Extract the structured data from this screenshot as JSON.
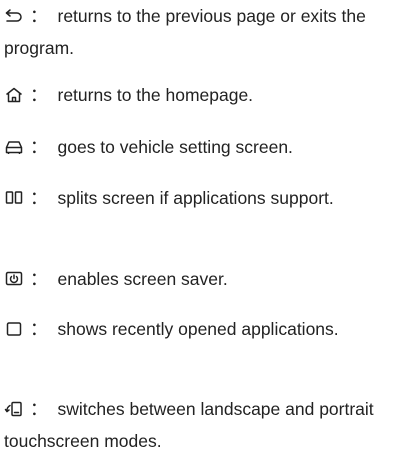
{
  "items": [
    {
      "icon": "back-arrow-icon",
      "colon": "：",
      "text": "returns to the previous page or exits the program."
    },
    {
      "icon": "home-icon",
      "colon": "：",
      "text": "returns to the homepage."
    },
    {
      "icon": "vehicle-icon",
      "colon": "：",
      "text": "goes to vehicle setting screen."
    },
    {
      "icon": "split-screen-icon",
      "colon": "：",
      "text": "splits screen if applications support."
    },
    {
      "icon": "screen-saver-icon",
      "colon": "：",
      "text": "enables screen saver."
    },
    {
      "icon": "recent-apps-icon",
      "colon": "：",
      "text": "shows recently opened applications."
    },
    {
      "icon": "rotate-screen-icon",
      "colon": "：",
      "text": "switches between landscape and portrait touchscreen modes."
    }
  ]
}
